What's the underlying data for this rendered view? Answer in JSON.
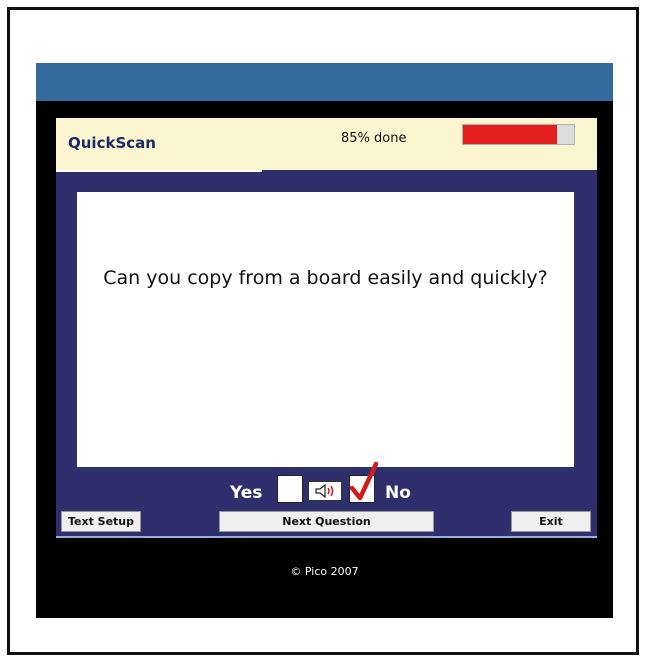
{
  "app": {
    "brand": "QuickScan",
    "progress_text": "85% done",
    "progress_fraction": 0.85
  },
  "question": {
    "text": "Can you copy from a board easily and quickly?"
  },
  "answers": {
    "yes_label": "Yes",
    "no_label": "No",
    "selected": "No",
    "speaker_icon": "speaker-icon",
    "check_icon": "red-checkmark-icon"
  },
  "buttons": {
    "text_setup": "Text Setup",
    "next_question": "Next Question",
    "exit": "Exit"
  },
  "footer": {
    "copyright": "© Pico 2007"
  },
  "colors": {
    "accent_blue": "#346a9c",
    "panel_navy": "#2f2f6e",
    "header_cream": "#fbf6cf",
    "progress_red": "#e3201e"
  }
}
